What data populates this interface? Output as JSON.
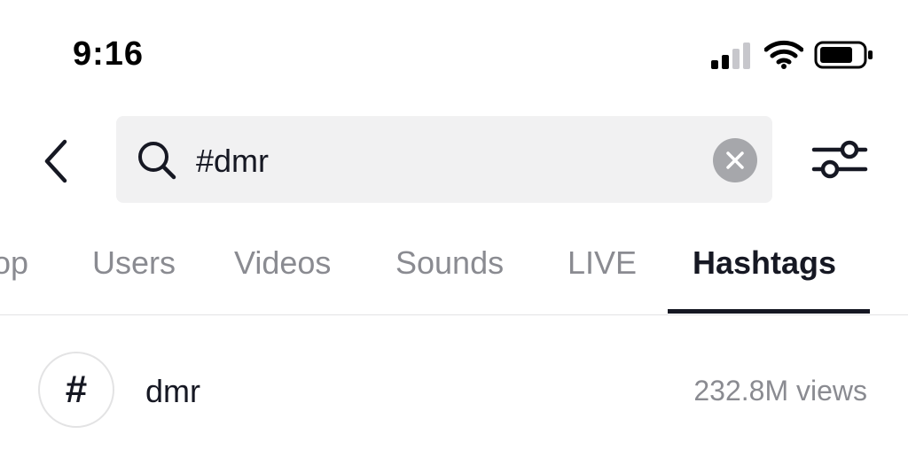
{
  "status_bar": {
    "time": "9:16",
    "icons": [
      "cellular-signal-icon",
      "wifi-icon",
      "battery-icon"
    ]
  },
  "search": {
    "value": "#dmr",
    "icons": {
      "back": "chevron-left-icon",
      "search": "magnifier-icon",
      "clear": "clear-x-icon",
      "filter": "sliders-icon"
    }
  },
  "tabs": [
    {
      "label": "Top",
      "visible_text": "op",
      "active": false
    },
    {
      "label": "Users",
      "active": false
    },
    {
      "label": "Videos",
      "active": false
    },
    {
      "label": "Sounds",
      "active": false
    },
    {
      "label": "LIVE",
      "active": false
    },
    {
      "label": "Hashtags",
      "active": true
    }
  ],
  "results": [
    {
      "symbol": "#",
      "name": "dmr",
      "views": "232.8M views"
    }
  ],
  "colors": {
    "text_primary": "#161823",
    "text_secondary": "#8a8b91",
    "search_bg": "#f1f1f2",
    "divider": "#e3e3e4",
    "clear_bg": "#a6a7ab"
  }
}
